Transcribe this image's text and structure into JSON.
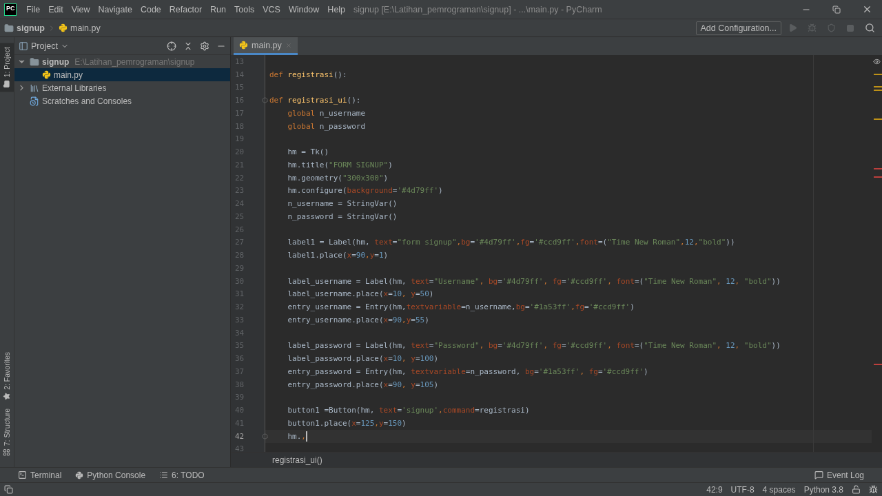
{
  "window": {
    "logo": "PC",
    "title": "signup [E:\\Latihan_pemrograman\\signup] - ...\\main.py - PyCharm"
  },
  "menu": [
    "File",
    "Edit",
    "View",
    "Navigate",
    "Code",
    "Refactor",
    "Run",
    "Tools",
    "VCS",
    "Window",
    "Help"
  ],
  "navbar": {
    "breadcrumb": [
      {
        "label": "signup",
        "kind": "folder"
      },
      {
        "label": "main.py",
        "kind": "python"
      }
    ],
    "run_config": "Add Configuration..."
  },
  "left_stripe": [
    {
      "label": "1: Project",
      "selected": true,
      "kind": "project"
    },
    {
      "label": "2: Favorites",
      "selected": false,
      "kind": "favorites"
    },
    {
      "label": "7: Structure",
      "selected": false,
      "kind": "structure"
    }
  ],
  "project_panel": {
    "title": "Project",
    "tree": [
      {
        "label": "signup",
        "path": "E:\\Latihan_pemrograman\\signup",
        "kind": "folder",
        "expanded": true,
        "selected": false,
        "children": [
          {
            "label": "main.py",
            "kind": "python",
            "selected": true
          }
        ]
      },
      {
        "label": "External Libraries",
        "kind": "library",
        "expanded": false,
        "selected": false
      },
      {
        "label": "Scratches and Consoles",
        "kind": "scratch",
        "selected": false
      }
    ]
  },
  "editor": {
    "tabs": [
      {
        "label": "main.py",
        "selected": true
      }
    ],
    "lines": [
      {
        "number": "13",
        "current": false,
        "fold": false
      },
      {
        "number": "14",
        "current": false,
        "fold": false,
        "tokens": [
          {
            "text": "def ",
            "kind": "kw"
          },
          {
            "text": "registrasi",
            "kind": "fn"
          },
          {
            "text": "():",
            "kind": "plain"
          }
        ]
      },
      {
        "number": "15",
        "current": false,
        "fold": false
      },
      {
        "number": "16",
        "current": false,
        "fold": true,
        "tokens": [
          {
            "text": "def ",
            "kind": "kw"
          },
          {
            "text": "registrasi_ui",
            "kind": "fn"
          },
          {
            "text": "():",
            "kind": "plain"
          }
        ]
      },
      {
        "number": "17",
        "current": false,
        "fold": false,
        "tokens": [
          {
            "text": "    global ",
            "kind": "kw"
          },
          {
            "text": "n_username",
            "kind": "plain"
          }
        ]
      },
      {
        "number": "18",
        "current": false,
        "fold": false,
        "tokens": [
          {
            "text": "    global ",
            "kind": "kw"
          },
          {
            "text": "n_password",
            "kind": "plain"
          }
        ]
      },
      {
        "number": "19",
        "current": false,
        "fold": false
      },
      {
        "number": "20",
        "current": false,
        "fold": false,
        "tokens": [
          {
            "text": "    hm = Tk()",
            "kind": "plain"
          }
        ]
      },
      {
        "number": "21",
        "current": false,
        "fold": false,
        "tokens": [
          {
            "text": "    hm.title(",
            "kind": "plain"
          },
          {
            "text": "\"FORM SIGNUP\"",
            "kind": "str"
          },
          {
            "text": ")",
            "kind": "plain"
          }
        ]
      },
      {
        "number": "22",
        "current": false,
        "fold": false,
        "tokens": [
          {
            "text": "    hm.geometry(",
            "kind": "plain"
          },
          {
            "text": "\"300x300\"",
            "kind": "str"
          },
          {
            "text": ")",
            "kind": "plain"
          }
        ]
      },
      {
        "number": "23",
        "current": false,
        "fold": false,
        "tokens": [
          {
            "text": "    hm.configure(",
            "kind": "plain"
          },
          {
            "text": "background",
            "kind": "param"
          },
          {
            "text": "=",
            "kind": "plain"
          },
          {
            "text": "'#4d79ff'",
            "kind": "str"
          },
          {
            "text": ")",
            "kind": "plain"
          }
        ]
      },
      {
        "number": "24",
        "current": false,
        "fold": false,
        "tokens": [
          {
            "text": "    n_username = StringVar()",
            "kind": "plain"
          }
        ]
      },
      {
        "number": "25",
        "current": false,
        "fold": false,
        "tokens": [
          {
            "text": "    n_password = StringVar()",
            "kind": "plain"
          }
        ]
      },
      {
        "number": "26",
        "current": false,
        "fold": false
      },
      {
        "number": "27",
        "current": false,
        "fold": false,
        "tokens": [
          {
            "text": "    label1 = Label(hm, ",
            "kind": "plain"
          },
          {
            "text": "text",
            "kind": "param"
          },
          {
            "text": "=",
            "kind": "plain"
          },
          {
            "text": "\"form signup\"",
            "kind": "str"
          },
          {
            "text": ",",
            "kind": "kw"
          },
          {
            "text": "bg",
            "kind": "param"
          },
          {
            "text": "=",
            "kind": "plain"
          },
          {
            "text": "'#4d79ff'",
            "kind": "str"
          },
          {
            "text": ",",
            "kind": "kw"
          },
          {
            "text": "fg",
            "kind": "param"
          },
          {
            "text": "=",
            "kind": "plain"
          },
          {
            "text": "'#ccd9ff'",
            "kind": "str"
          },
          {
            "text": ",",
            "kind": "kw"
          },
          {
            "text": "font",
            "kind": "param"
          },
          {
            "text": "=(",
            "kind": "plain"
          },
          {
            "text": "\"Time New Roman\"",
            "kind": "str"
          },
          {
            "text": ",",
            "kind": "kw"
          },
          {
            "text": "12",
            "kind": "num"
          },
          {
            "text": ",",
            "kind": "kw"
          },
          {
            "text": "\"bold\"",
            "kind": "str"
          },
          {
            "text": "))",
            "kind": "plain"
          }
        ]
      },
      {
        "number": "28",
        "current": false,
        "fold": false,
        "tokens": [
          {
            "text": "    label1.place(",
            "kind": "plain"
          },
          {
            "text": "x",
            "kind": "param"
          },
          {
            "text": "=",
            "kind": "plain"
          },
          {
            "text": "90",
            "kind": "num"
          },
          {
            "text": ",",
            "kind": "kw"
          },
          {
            "text": "y",
            "kind": "param"
          },
          {
            "text": "=",
            "kind": "plain"
          },
          {
            "text": "1",
            "kind": "num"
          },
          {
            "text": ")",
            "kind": "plain"
          }
        ]
      },
      {
        "number": "29",
        "current": false,
        "fold": false
      },
      {
        "number": "30",
        "current": false,
        "fold": false,
        "tokens": [
          {
            "text": "    label_username = Label(hm, ",
            "kind": "plain"
          },
          {
            "text": "text",
            "kind": "param"
          },
          {
            "text": "=",
            "kind": "plain"
          },
          {
            "text": "\"Username\"",
            "kind": "str"
          },
          {
            "text": ", ",
            "kind": "kw"
          },
          {
            "text": "bg",
            "kind": "param"
          },
          {
            "text": "=",
            "kind": "plain"
          },
          {
            "text": "'#4d79ff'",
            "kind": "str"
          },
          {
            "text": ", ",
            "kind": "kw"
          },
          {
            "text": "fg",
            "kind": "param"
          },
          {
            "text": "=",
            "kind": "plain"
          },
          {
            "text": "'#ccd9ff'",
            "kind": "str"
          },
          {
            "text": ", ",
            "kind": "kw"
          },
          {
            "text": "font",
            "kind": "param"
          },
          {
            "text": "=(",
            "kind": "plain"
          },
          {
            "text": "\"Time New Roman\"",
            "kind": "str"
          },
          {
            "text": ", ",
            "kind": "kw"
          },
          {
            "text": "12",
            "kind": "num"
          },
          {
            "text": ", ",
            "kind": "kw"
          },
          {
            "text": "\"bold\"",
            "kind": "str"
          },
          {
            "text": "))",
            "kind": "plain"
          }
        ]
      },
      {
        "number": "31",
        "current": false,
        "fold": false,
        "tokens": [
          {
            "text": "    label_username.place(",
            "kind": "plain"
          },
          {
            "text": "x",
            "kind": "param"
          },
          {
            "text": "=",
            "kind": "plain"
          },
          {
            "text": "10",
            "kind": "num"
          },
          {
            "text": ", ",
            "kind": "kw"
          },
          {
            "text": "y",
            "kind": "param"
          },
          {
            "text": "=",
            "kind": "plain"
          },
          {
            "text": "50",
            "kind": "num"
          },
          {
            "text": ")",
            "kind": "plain"
          }
        ]
      },
      {
        "number": "32",
        "current": false,
        "fold": false,
        "tokens": [
          {
            "text": "    entry_username = Entry(hm,",
            "kind": "plain"
          },
          {
            "text": "textvariable",
            "kind": "param"
          },
          {
            "text": "=n_username,",
            "kind": "plain"
          },
          {
            "text": "bg",
            "kind": "param"
          },
          {
            "text": "=",
            "kind": "plain"
          },
          {
            "text": "'#1a53ff'",
            "kind": "str"
          },
          {
            "text": ",",
            "kind": "kw"
          },
          {
            "text": "fg",
            "kind": "param"
          },
          {
            "text": "=",
            "kind": "plain"
          },
          {
            "text": "'#ccd9ff'",
            "kind": "str"
          },
          {
            "text": ")",
            "kind": "plain"
          }
        ]
      },
      {
        "number": "33",
        "current": false,
        "fold": false,
        "tokens": [
          {
            "text": "    entry_username.place(",
            "kind": "plain"
          },
          {
            "text": "x",
            "kind": "param"
          },
          {
            "text": "=",
            "kind": "plain"
          },
          {
            "text": "90",
            "kind": "num"
          },
          {
            "text": ",",
            "kind": "kw"
          },
          {
            "text": "y",
            "kind": "param"
          },
          {
            "text": "=",
            "kind": "plain"
          },
          {
            "text": "55",
            "kind": "num"
          },
          {
            "text": ")",
            "kind": "plain"
          }
        ]
      },
      {
        "number": "34",
        "current": false,
        "fold": false
      },
      {
        "number": "35",
        "current": false,
        "fold": false,
        "tokens": [
          {
            "text": "    label_password = Label(hm, ",
            "kind": "plain"
          },
          {
            "text": "text",
            "kind": "param"
          },
          {
            "text": "=",
            "kind": "plain"
          },
          {
            "text": "\"Password\"",
            "kind": "str"
          },
          {
            "text": ", ",
            "kind": "kw"
          },
          {
            "text": "bg",
            "kind": "param"
          },
          {
            "text": "=",
            "kind": "plain"
          },
          {
            "text": "'#4d79ff'",
            "kind": "str"
          },
          {
            "text": ", ",
            "kind": "kw"
          },
          {
            "text": "fg",
            "kind": "param"
          },
          {
            "text": "=",
            "kind": "plain"
          },
          {
            "text": "'#ccd9ff'",
            "kind": "str"
          },
          {
            "text": ", ",
            "kind": "kw"
          },
          {
            "text": "font",
            "kind": "param"
          },
          {
            "text": "=(",
            "kind": "plain"
          },
          {
            "text": "\"Time New Roman\"",
            "kind": "str"
          },
          {
            "text": ", ",
            "kind": "kw"
          },
          {
            "text": "12",
            "kind": "num"
          },
          {
            "text": ", ",
            "kind": "kw"
          },
          {
            "text": "\"bold\"",
            "kind": "str"
          },
          {
            "text": "))",
            "kind": "plain"
          }
        ]
      },
      {
        "number": "36",
        "current": false,
        "fold": false,
        "tokens": [
          {
            "text": "    label_password.place(",
            "kind": "plain"
          },
          {
            "text": "x",
            "kind": "param"
          },
          {
            "text": "=",
            "kind": "plain"
          },
          {
            "text": "10",
            "kind": "num"
          },
          {
            "text": ", ",
            "kind": "kw"
          },
          {
            "text": "y",
            "kind": "param"
          },
          {
            "text": "=",
            "kind": "plain"
          },
          {
            "text": "100",
            "kind": "num"
          },
          {
            "text": ")",
            "kind": "plain"
          }
        ]
      },
      {
        "number": "37",
        "current": false,
        "fold": false,
        "tokens": [
          {
            "text": "    entry_password = Entry(hm, ",
            "kind": "plain"
          },
          {
            "text": "textvariable",
            "kind": "param"
          },
          {
            "text": "=n_password, ",
            "kind": "plain"
          },
          {
            "text": "bg",
            "kind": "param"
          },
          {
            "text": "=",
            "kind": "plain"
          },
          {
            "text": "'#1a53ff'",
            "kind": "str"
          },
          {
            "text": ", ",
            "kind": "kw"
          },
          {
            "text": "fg",
            "kind": "param"
          },
          {
            "text": "=",
            "kind": "plain"
          },
          {
            "text": "'#ccd9ff'",
            "kind": "str"
          },
          {
            "text": ")",
            "kind": "plain"
          }
        ]
      },
      {
        "number": "38",
        "current": false,
        "fold": false,
        "tokens": [
          {
            "text": "    entry_password.place(",
            "kind": "plain"
          },
          {
            "text": "x",
            "kind": "param"
          },
          {
            "text": "=",
            "kind": "plain"
          },
          {
            "text": "90",
            "kind": "num"
          },
          {
            "text": ", ",
            "kind": "kw"
          },
          {
            "text": "y",
            "kind": "param"
          },
          {
            "text": "=",
            "kind": "plain"
          },
          {
            "text": "105",
            "kind": "num"
          },
          {
            "text": ")",
            "kind": "plain"
          }
        ]
      },
      {
        "number": "39",
        "current": false,
        "fold": false
      },
      {
        "number": "40",
        "current": false,
        "fold": false,
        "tokens": [
          {
            "text": "    button1 =Button(hm, ",
            "kind": "plain"
          },
          {
            "text": "text",
            "kind": "param"
          },
          {
            "text": "=",
            "kind": "plain"
          },
          {
            "text": "'signup'",
            "kind": "str"
          },
          {
            "text": ",",
            "kind": "kw"
          },
          {
            "text": "command",
            "kind": "param"
          },
          {
            "text": "=registrasi)",
            "kind": "plain"
          }
        ]
      },
      {
        "number": "41",
        "current": false,
        "fold": false,
        "tokens": [
          {
            "text": "    button1.place(",
            "kind": "plain"
          },
          {
            "text": "x",
            "kind": "param"
          },
          {
            "text": "=",
            "kind": "plain"
          },
          {
            "text": "125",
            "kind": "num"
          },
          {
            "text": ",",
            "kind": "kw"
          },
          {
            "text": "y",
            "kind": "param"
          },
          {
            "text": "=",
            "kind": "plain"
          },
          {
            "text": "150",
            "kind": "num"
          },
          {
            "text": ")",
            "kind": "plain"
          }
        ]
      },
      {
        "number": "42",
        "current": true,
        "fold": true,
        "tokens": [
          {
            "text": "    hm.",
            "kind": "plain"
          },
          {
            "text": ",",
            "kind": "kw"
          }
        ]
      },
      {
        "number": "43",
        "current": false,
        "fold": false
      }
    ],
    "breadcrumb": "registrasi_ui()"
  },
  "tool_windows": [
    {
      "label": "Terminal",
      "kind": "terminal"
    },
    {
      "label": "Python Console",
      "kind": "python"
    },
    {
      "label": "6: TODO",
      "kind": "todo"
    }
  ],
  "event_log": "Event Log",
  "status_bar": [
    "42:9",
    "UTF-8",
    "4 spaces",
    "Python 3.8"
  ]
}
